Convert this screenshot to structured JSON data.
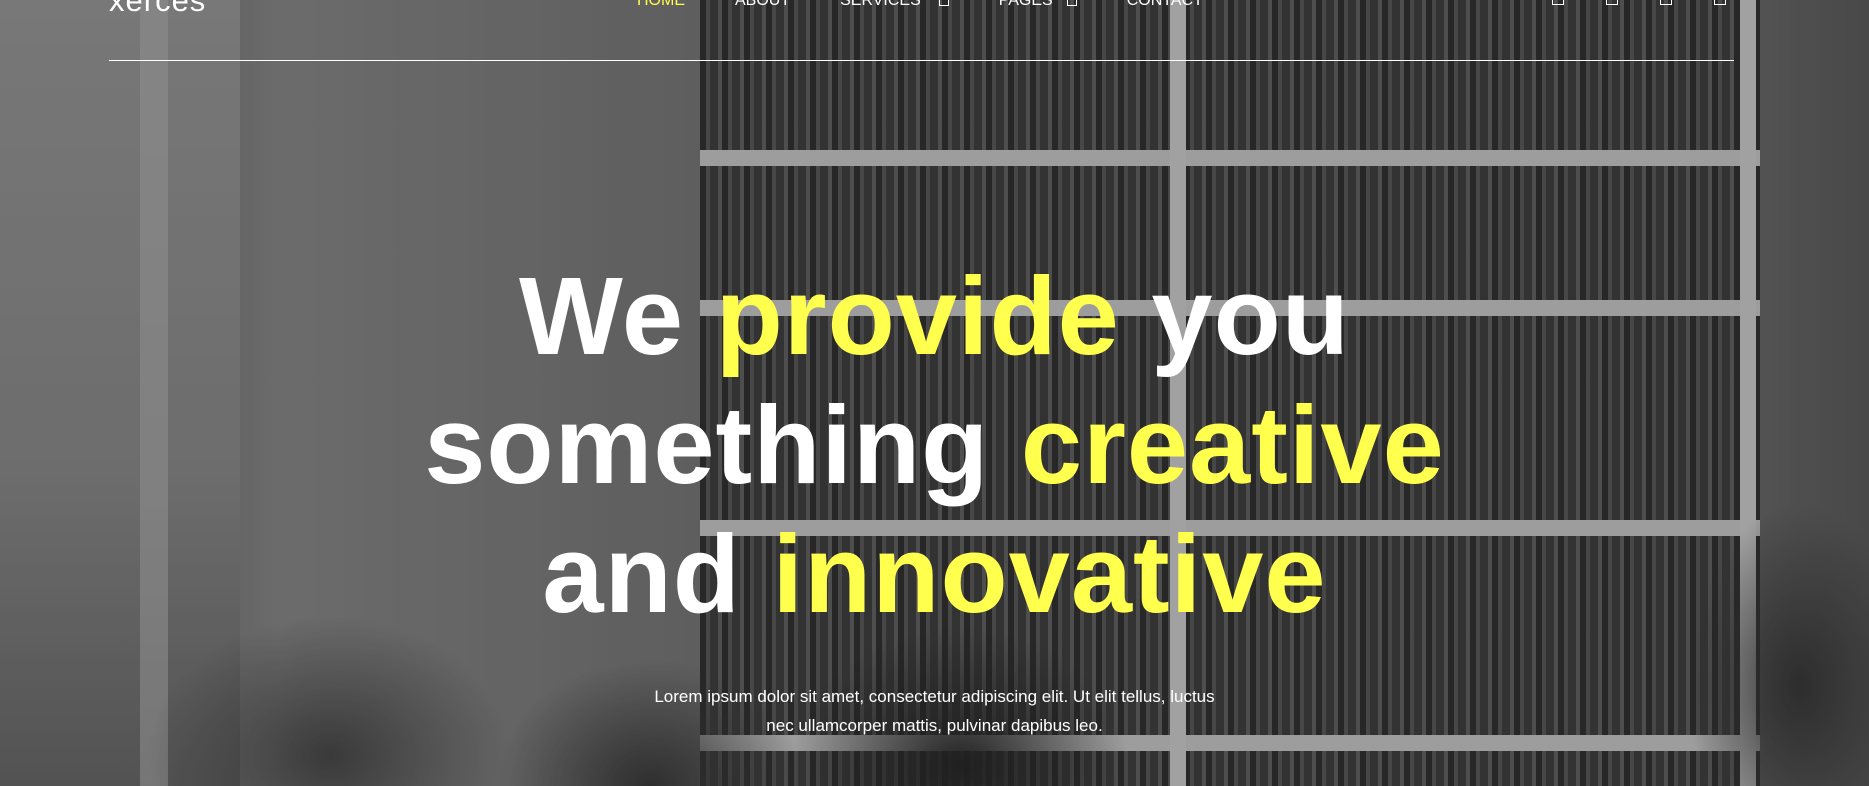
{
  "brand": {
    "logo_text": "xerces"
  },
  "nav": {
    "items": [
      {
        "label": "HOME",
        "active": true
      },
      {
        "label": "ABOUT"
      },
      {
        "label": "SERVICES"
      },
      {
        "label": "PAGES"
      },
      {
        "label": "CONTACT"
      }
    ]
  },
  "socials": [
    "facebook-icon",
    "twitter-icon",
    "instagram-icon",
    "linkedin-icon"
  ],
  "hero": {
    "line1_a": "We ",
    "line1_b": "provide",
    "line1_c": " you",
    "line2_a": "something ",
    "line2_b": "creative",
    "line3_a": "and ",
    "line3_b": "innovative",
    "sub_line1": "Lorem ipsum dolor sit amet, consectetur adipiscing elit. Ut elit tellus, luctus",
    "sub_line2": "nec ullamcorper mattis, pulvinar dapibus leo."
  },
  "colors": {
    "accent": "#ffff4d",
    "text": "#ffffff"
  }
}
